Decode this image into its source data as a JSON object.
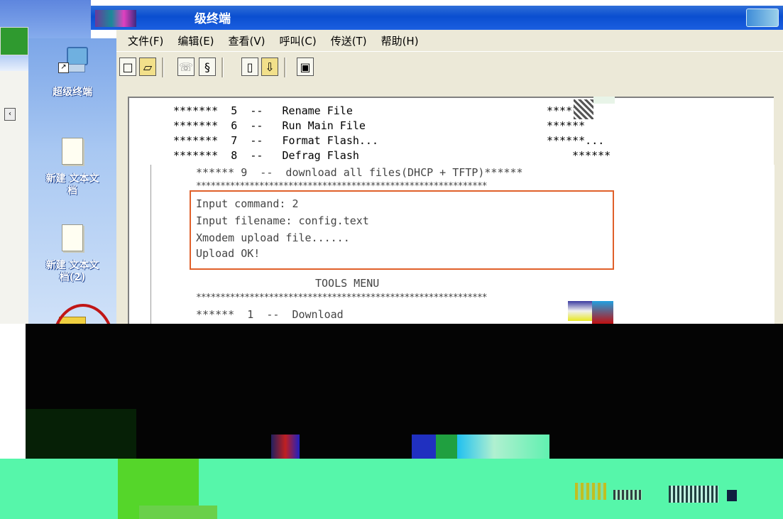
{
  "window": {
    "title": "级终端"
  },
  "menu": {
    "items": [
      "文件(F)",
      "编辑(E)",
      "查看(V)",
      "呼叫(C)",
      "传送(T)",
      "帮助(H)"
    ]
  },
  "desktop": {
    "icons": [
      {
        "label": "超级终端",
        "icon": "computer-shortcut-icon"
      },
      {
        "label": "新建 文本文档",
        "icon": "text-document-icon"
      },
      {
        "label": "新建 文本文档(2)",
        "icon": "text-document-icon"
      }
    ]
  },
  "terminal": {
    "menu_lines": [
      {
        "stars": "*******",
        "num": "5",
        "sep": "--",
        "text": "Rename File",
        "tail": "*****"
      },
      {
        "stars": "*******",
        "num": "6",
        "sep": "--",
        "text": "Run Main File",
        "tail": "******"
      },
      {
        "stars": "*******",
        "num": "7",
        "sep": "--",
        "text": "Format Flash...",
        "tail": "******..."
      },
      {
        "stars": "*******",
        "num": "8",
        "sep": "--",
        "text": "Defrag Flash",
        "tail": "******"
      }
    ],
    "line_9": "****** 9  --  download all files(DHCP + TFTP)******",
    "stars_row": "************************************************************",
    "upload_box": [
      "Input command: 2",
      "Input filename: config.text",
      "Xmodem upload file......",
      "Upload OK!"
    ],
    "tools_menu_title": "TOOLS MENU",
    "tools_line_1": "******  1  --  Download"
  },
  "colors": {
    "titlebar": "#0a4ed0",
    "menubar": "#ece9d8",
    "highlight_box": "#e0602a",
    "highlight_circle": "#c01616",
    "bottom_band": "#56f6aa"
  }
}
